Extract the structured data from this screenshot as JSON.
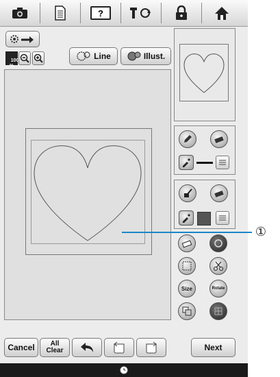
{
  "toolbar": {
    "icons": [
      "camera-icon",
      "document-icon",
      "help-icon",
      "thread-change-icon",
      "lock-icon",
      "home-icon"
    ],
    "help_label": "?"
  },
  "row1": {
    "zoom_level": "100\n%",
    "line_label": "Line",
    "illust_label": "Illust."
  },
  "right_tools": {
    "size_label": "Size",
    "rotate_label": "Rotate"
  },
  "bottom": {
    "cancel_label": "Cancel",
    "all_clear_label": "All\nClear",
    "next_label": "Next"
  },
  "callout": {
    "number": "①"
  },
  "colors": {
    "callout_line": "#1a85c8",
    "fill_swatch": "#555555",
    "line_swatch": "#111111"
  }
}
